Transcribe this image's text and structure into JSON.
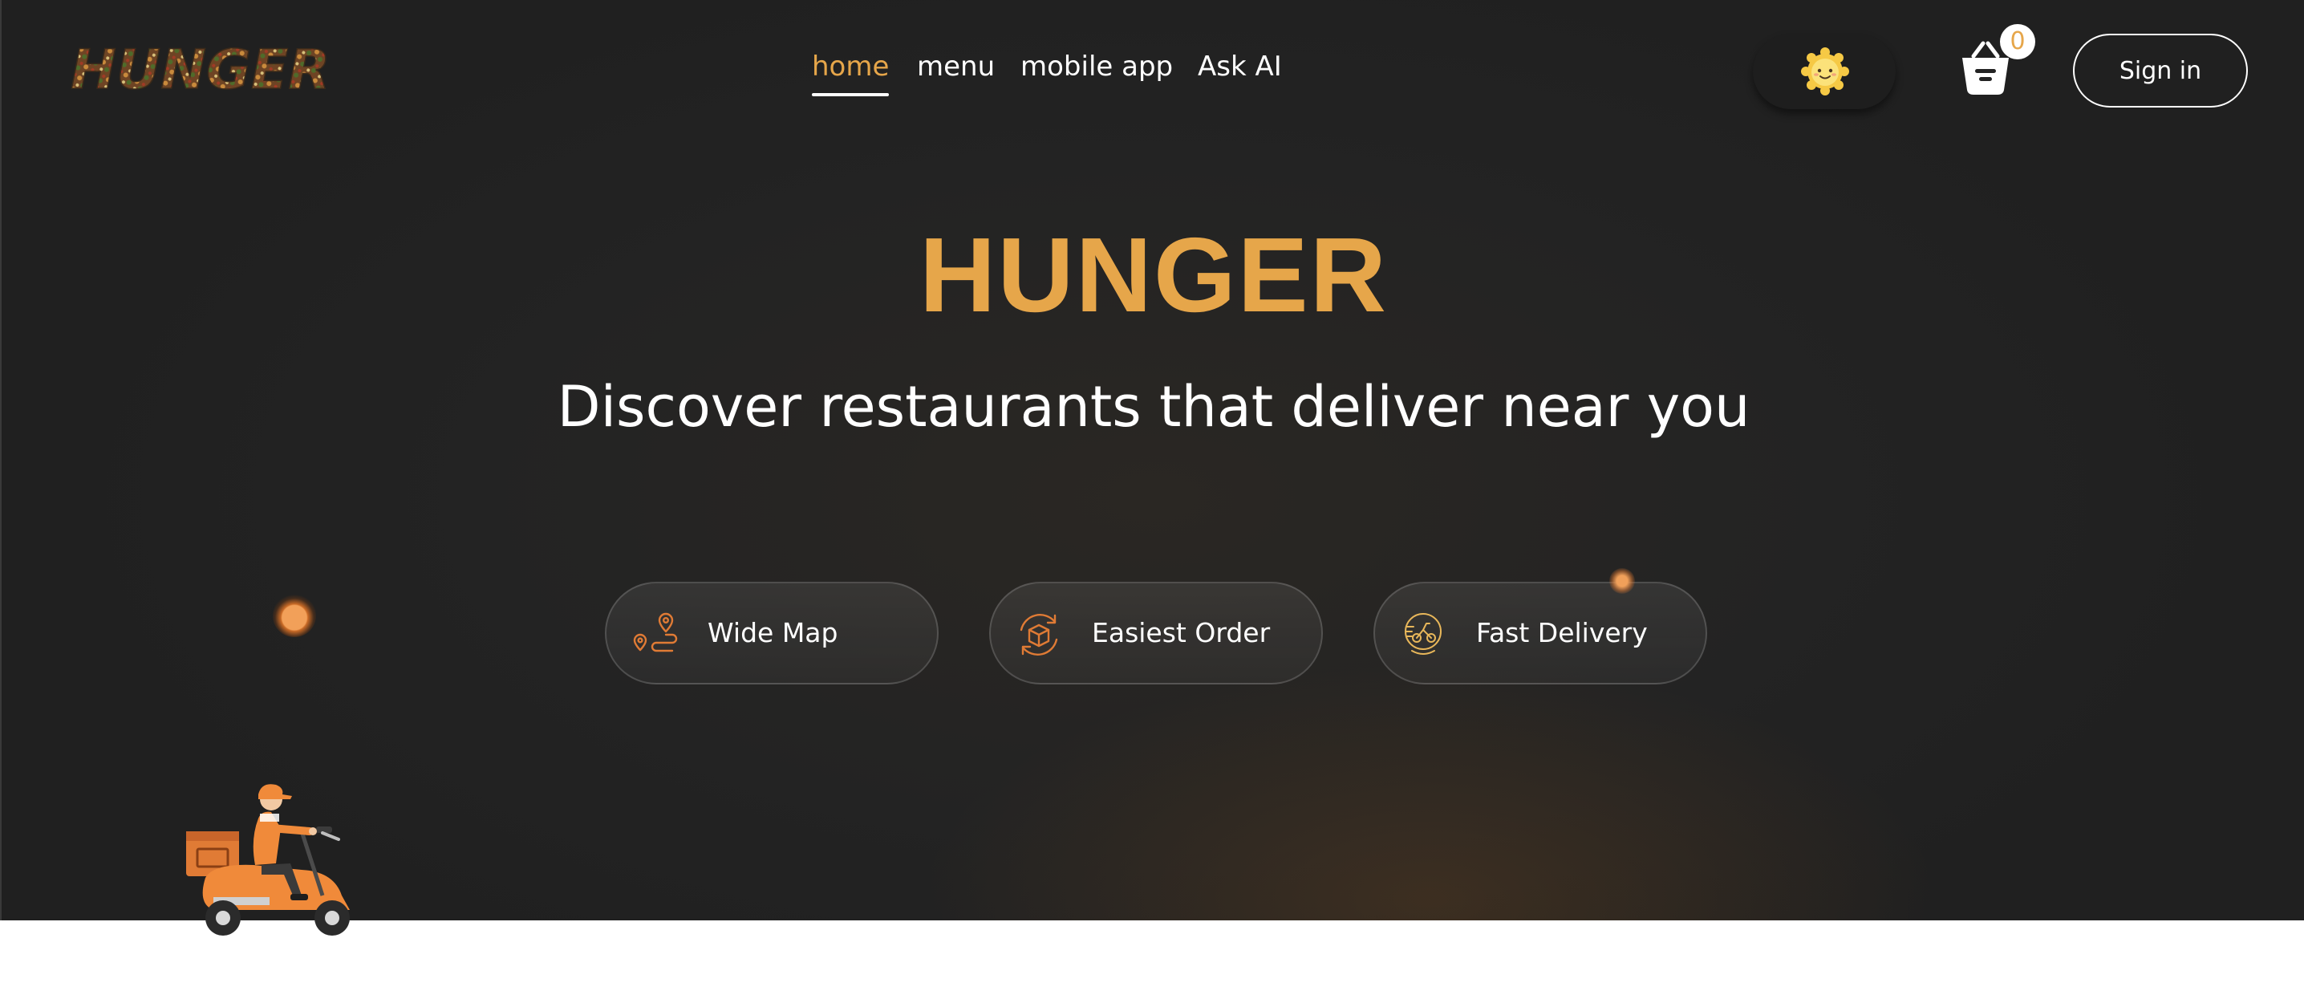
{
  "brand": {
    "logo_text": "HUNGER"
  },
  "nav": {
    "items": [
      {
        "label": "home",
        "active": true
      },
      {
        "label": "menu",
        "active": false
      },
      {
        "label": "mobile app",
        "active": false
      },
      {
        "label": "Ask AI",
        "active": false
      }
    ]
  },
  "header": {
    "cart_count": "0",
    "signin_label": "Sign in",
    "theme_icon": "sun-icon",
    "cart_icon": "basket-icon"
  },
  "hero": {
    "title": "HUNGER",
    "subtitle": "Discover restaurants that deliver near you"
  },
  "features": [
    {
      "label": "Wide Map",
      "icon": "map-route-icon"
    },
    {
      "label": "Easiest Order",
      "icon": "box-cycle-icon"
    },
    {
      "label": "Fast Delivery",
      "icon": "delivery-icon"
    }
  ],
  "colors": {
    "accent": "#e6a64a",
    "background": "#232323",
    "text": "#ffffff"
  }
}
